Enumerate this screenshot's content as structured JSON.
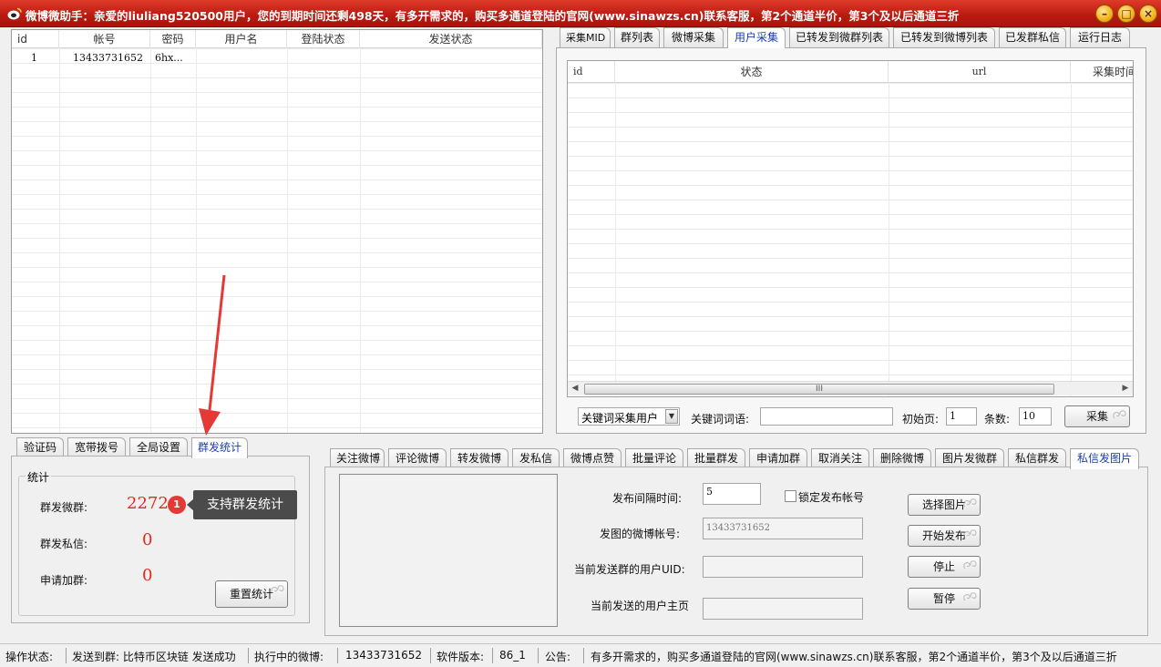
{
  "window": {
    "title": "微博微助手：亲爱的liuliang520500用户，您的到期时间还剩498天，有多开需求的，购买多通道登陆的官网(www.sinawzs.cn)联系客服，第2个通道半价，第3个及以后通道三折",
    "min": "–",
    "max": "□",
    "close": "×"
  },
  "account_table": {
    "headers": [
      "id",
      "帐号",
      "密码",
      "用户名",
      "登陆状态",
      "发送状态"
    ],
    "rows": [
      {
        "id": "1",
        "account": "13433731652",
        "password": "6hx...",
        "username": "",
        "login_status": "",
        "send_status": ""
      }
    ]
  },
  "right_tabs": [
    "采集MID",
    "群列表",
    "微博采集",
    "用户采集",
    "已转发到微群列表",
    "已转发到微博列表",
    "已发群私信",
    "运行日志"
  ],
  "right_active_tab": "用户采集",
  "collect_table": {
    "headers": [
      "id",
      "状态",
      "url",
      "采集时间"
    ]
  },
  "scroll_thumb_grip": "III",
  "collect_controls": {
    "mode": "关键词采集用户",
    "keyword_label": "关键词词语:",
    "keyword_value": "",
    "start_page_label": "初始页:",
    "start_page": "1",
    "count_label": "条数:",
    "count": "10",
    "collect_button": "采集"
  },
  "left_tabs": [
    "验证码",
    "宽带拨号",
    "全局设置",
    "群发统计"
  ],
  "left_active_tab": "群发统计",
  "stats": {
    "legend": "统计",
    "group_weibo_label": "群发微群:",
    "group_weibo_value": "2272",
    "private_msg_label": "群发私信:",
    "private_msg_value": "0",
    "join_group_label": "申请加群:",
    "join_group_value": "0",
    "reset_button": "重置统计"
  },
  "annotation": {
    "badge": "1",
    "callout": "支持群发统计"
  },
  "bottom_tabs": [
    "关注微博",
    "评论微博",
    "转发微博",
    "发私信",
    "微博点赞",
    "批量评论",
    "批量群发",
    "申请加群",
    "取消关注",
    "删除微博",
    "图片发微群",
    "私信群发",
    "私信发图片"
  ],
  "bottom_active_tab": "私信发图片",
  "image_dm": {
    "interval_label": "发布间隔时间:",
    "interval_value": "5",
    "lock_label": "锁定发布帐号",
    "account_label": "发图的微博帐号:",
    "account_value": "13433731652",
    "uid_label": "当前发送群的用户UID:",
    "uid_value": "",
    "home_label": "当前发送的用户主页",
    "home_value": "",
    "select_image": "选择图片",
    "start_publish": "开始发布",
    "stop": "停止",
    "pause": "暂停"
  },
  "statusbar": {
    "op_label": "操作状态:",
    "op_value": "发送到群: 比特币区块链 发送成功",
    "running_label": "执行中的微博:",
    "running_value": "13433731652",
    "version_label": "软件版本:",
    "version_value": "86_1",
    "notice_label": "公告:",
    "notice_value": "有多开需求的，购买多通道登陆的官网(www.sinawzs.cn)联系客服，第2个通道半价，第3个及以后通道三折"
  }
}
